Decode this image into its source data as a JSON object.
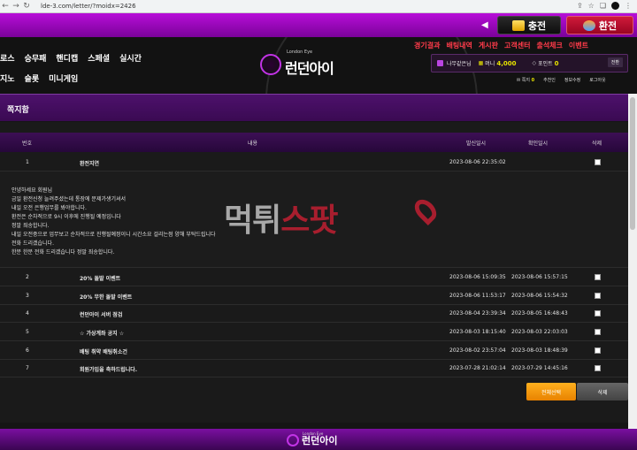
{
  "browser": {
    "url": "lde-3.com/letter/?moidx=2426",
    "back_icon": "←",
    "forward_icon": "→",
    "reload_icon": "↻",
    "lock_icon": "🔒"
  },
  "topbar": {
    "deposit": "충전",
    "withdraw": "환전"
  },
  "header": {
    "menu_row1": [
      "로스",
      "승무패",
      "핸디캡",
      "스페셜",
      "실시간"
    ],
    "menu_row2": [
      "지노",
      "슬롯",
      "미니게임"
    ],
    "logo_small": "London Eye",
    "logo": "런던아이",
    "right_menu": [
      "경기결과",
      "배팅내역",
      "게시판",
      "고객센터",
      "출석체크",
      "이벤트"
    ],
    "user": {
      "nick": "나무같은님",
      "money_label": "머니",
      "money": "4,000",
      "point_label": "포인트",
      "point": "0",
      "exchange": "전환",
      "message_label": "쪽지",
      "message_count": "0",
      "recommend": "추천인",
      "edit_profile": "정보수정",
      "logout": "로그아웃"
    }
  },
  "page": {
    "title": "쪽지함"
  },
  "table": {
    "headers": {
      "no": "번호",
      "content": "내용",
      "sent": "발신일시",
      "read": "확인일시",
      "delete": "삭제"
    },
    "rows": [
      {
        "no": "1",
        "title": "환전지연",
        "sent": "2023-08-06 22:35:02",
        "read": ""
      },
      {
        "no": "2",
        "title": "20% 돌발 이벤트",
        "sent": "2023-08-06 15:09:35",
        "read": "2023-08-06 15:57:15"
      },
      {
        "no": "3",
        "title": "20% 무한 돌발 이벤트",
        "sent": "2023-08-06 11:53:17",
        "read": "2023-08-06 15:54:32"
      },
      {
        "no": "4",
        "title": "런던아이 서버 점검",
        "sent": "2023-08-04 23:39:34",
        "read": "2023-08-05 16:48:43"
      },
      {
        "no": "5",
        "title": "☆ 가상계좌 공지 ☆",
        "sent": "2023-08-03 18:15:40",
        "read": "2023-08-03 22:03:03"
      },
      {
        "no": "6",
        "title": "배팅 취약 배팅취소건",
        "sent": "2023-08-02 23:57:04",
        "read": "2023-08-03 18:48:39"
      },
      {
        "no": "7",
        "title": "회원가입을 축하드립니다.",
        "sent": "2023-07-28 21:02:14",
        "read": "2023-07-29 14:45:16"
      }
    ],
    "detail_lines": [
      "안녕하세요 회원님",
      "금일 환전신청 늘려주셨는데 통장에 문제가생기셔서",
      "내일 오전 은행업무를 봐야합니다.",
      "환전은 순차적으로 9시 이후에 진행될 예정입니다",
      "정말 죄송합니다.",
      "내일 오전중으로 업무보고 순차적으로 진행될예정이니 시간소요 걸리는점 양해 부탁드립니다",
      "전화 드리겠습니다.",
      "한분 한분 전화 드리겠습니다 정말 죄송합니다."
    ],
    "select_all": "전체선택",
    "delete_button": "삭제"
  },
  "watermark": {
    "part1": "먹튀",
    "part2": "스팟"
  },
  "footer": {
    "logo_small": "London Eye",
    "logo": "런던아이"
  }
}
